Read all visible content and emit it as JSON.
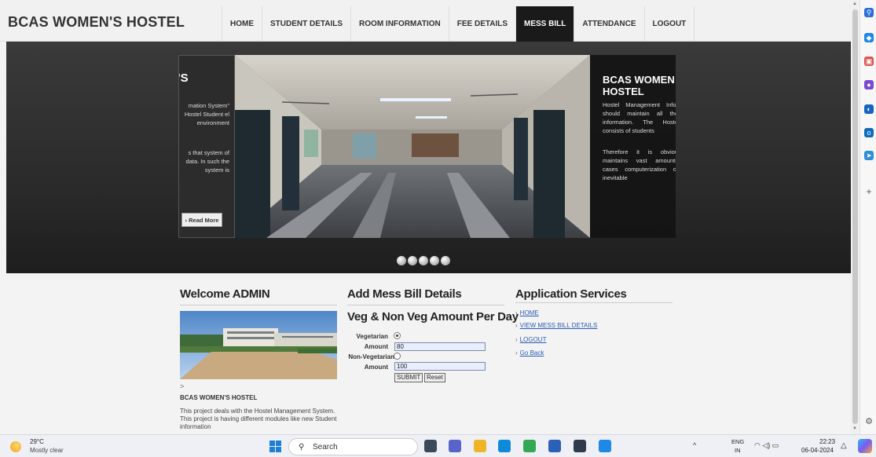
{
  "site": {
    "title": "BCAS WOMEN'S HOSTEL"
  },
  "nav": {
    "items": [
      {
        "label": "HOME"
      },
      {
        "label": "STUDENT DETAILS"
      },
      {
        "label": "ROOM INFORMATION"
      },
      {
        "label": "FEE DETAILS"
      },
      {
        "label": "MESS BILL",
        "active": true
      },
      {
        "label": "ATTENDANCE"
      },
      {
        "label": "LOGOUT"
      }
    ]
  },
  "slider": {
    "left_title": "'S",
    "left_para1": "mation System\" Hostel Student el environment",
    "left_para2": "s that system of data. In such the system is",
    "read_more": "› Read More",
    "right_title": "BCAS WOMEN HOSTEL",
    "right_para1": "Hostel Management Infor should maintain all the information. The Hoste consists of students",
    "right_para2": "Therefore it is obviou maintains vast amounts cases computerization of inevitable"
  },
  "welcome": {
    "heading": "Welcome ADMIN",
    "arrow": ">",
    "subheading": "BCAS WOMEN'S HOSTEL",
    "description": "This project deals with the Hostel Management System. This project is having different modules like new Student information"
  },
  "form": {
    "heading": "Add Mess Bill Details",
    "subheading": "Veg & Non Veg Amount Per Day",
    "veg_label": "Vegetarian",
    "amount_label": "Amount",
    "veg_amount": "80",
    "nonveg_label": "Non-Vegetarian",
    "amount_label2": "Amount",
    "nonveg_amount": "100",
    "submit_label": "SUBMIT",
    "reset_label": "Reset"
  },
  "services": {
    "heading": "Application Services",
    "links": [
      {
        "label": "HOME"
      },
      {
        "label": "VIEW MESS BILL DETAILS"
      },
      {
        "label": "LOGOUT"
      },
      {
        "label": "Go Back"
      }
    ]
  },
  "taskbar": {
    "temperature": "29°C",
    "weather": "Mostly clear",
    "search": "Search",
    "lang_1": "ENG",
    "lang_2": "IN",
    "time": "22:23",
    "date": "06-04-2024"
  }
}
